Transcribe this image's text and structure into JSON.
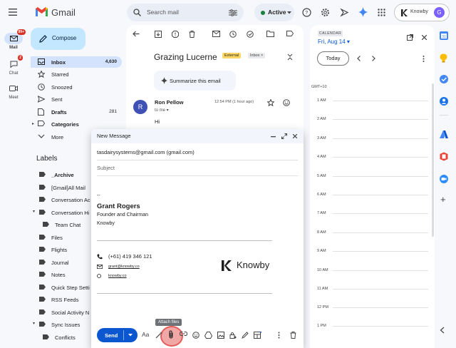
{
  "rail": {
    "mail_label": "Mail",
    "mail_badge": "99+",
    "chat_label": "Chat",
    "chat_badge": "2",
    "meet_label": "Meet"
  },
  "header": {
    "app_name": "Gmail",
    "search_placeholder": "Search mail",
    "status_label": "Active",
    "status_color": "#188038",
    "account_label": "Knowby",
    "avatar_letter": "G"
  },
  "sidebar": {
    "compose_label": "Compose",
    "items": [
      {
        "label": "Inbox",
        "count": "4,630"
      },
      {
        "label": "Starred",
        "count": ""
      },
      {
        "label": "Snoozed",
        "count": ""
      },
      {
        "label": "Sent",
        "count": ""
      },
      {
        "label": "Drafts",
        "count": "281"
      },
      {
        "label": "Categories",
        "count": ""
      },
      {
        "label": "More",
        "count": ""
      }
    ],
    "labels_title": "Labels",
    "labels": [
      {
        "label": "_Archive"
      },
      {
        "label": "[Gmail]All Mail"
      },
      {
        "label": "Conversation Ac"
      },
      {
        "label": "Conversation Hi"
      },
      {
        "label": "Team Chat"
      },
      {
        "label": "Files"
      },
      {
        "label": "Flights"
      },
      {
        "label": "Journal"
      },
      {
        "label": "Notes"
      },
      {
        "label": "Quick Step Setti"
      },
      {
        "label": "RSS Feeds"
      },
      {
        "label": "Social Activity N"
      },
      {
        "label": "Sync Issues"
      },
      {
        "label": "Conflicts"
      }
    ]
  },
  "email": {
    "subject": "Grazing Lucerne",
    "tag_external": "External",
    "tag_inbox": "Inbox ×",
    "summarize_label": "Summarize this email",
    "sender_initial": "R",
    "sender_name": "Ron Pellow",
    "to_me": "to me ▾",
    "time": "12:54 PM (1 hour ago)",
    "body": "Hi"
  },
  "compose": {
    "title": "New Message",
    "to_value": "tasdairysystems@gmail.com (gmail.com)",
    "subject_placeholder": "Subject",
    "sig_dashes": "--",
    "sig_name": "Grant Rogers",
    "sig_title": "Founder and Chairman",
    "sig_company": "Knowby",
    "sig_phone": "(+61) 419 346 121",
    "sig_email": "grant@knowby.co",
    "sig_web": "knowby.co",
    "logo_text": "Knowby",
    "send_label": "Send",
    "attach_tooltip": "Attach files"
  },
  "calendar": {
    "title": "CALENDAR",
    "date_label": "Fri, Aug 14 ▾",
    "today_label": "Today",
    "gmt_label": "GMT+10",
    "hours": [
      "1 AM",
      "2 AM",
      "3 AM",
      "4 AM",
      "5 AM",
      "6 AM",
      "7 AM",
      "8 AM",
      "9 AM",
      "10 AM",
      "11 AM",
      "12 PM",
      "1 PM"
    ]
  }
}
